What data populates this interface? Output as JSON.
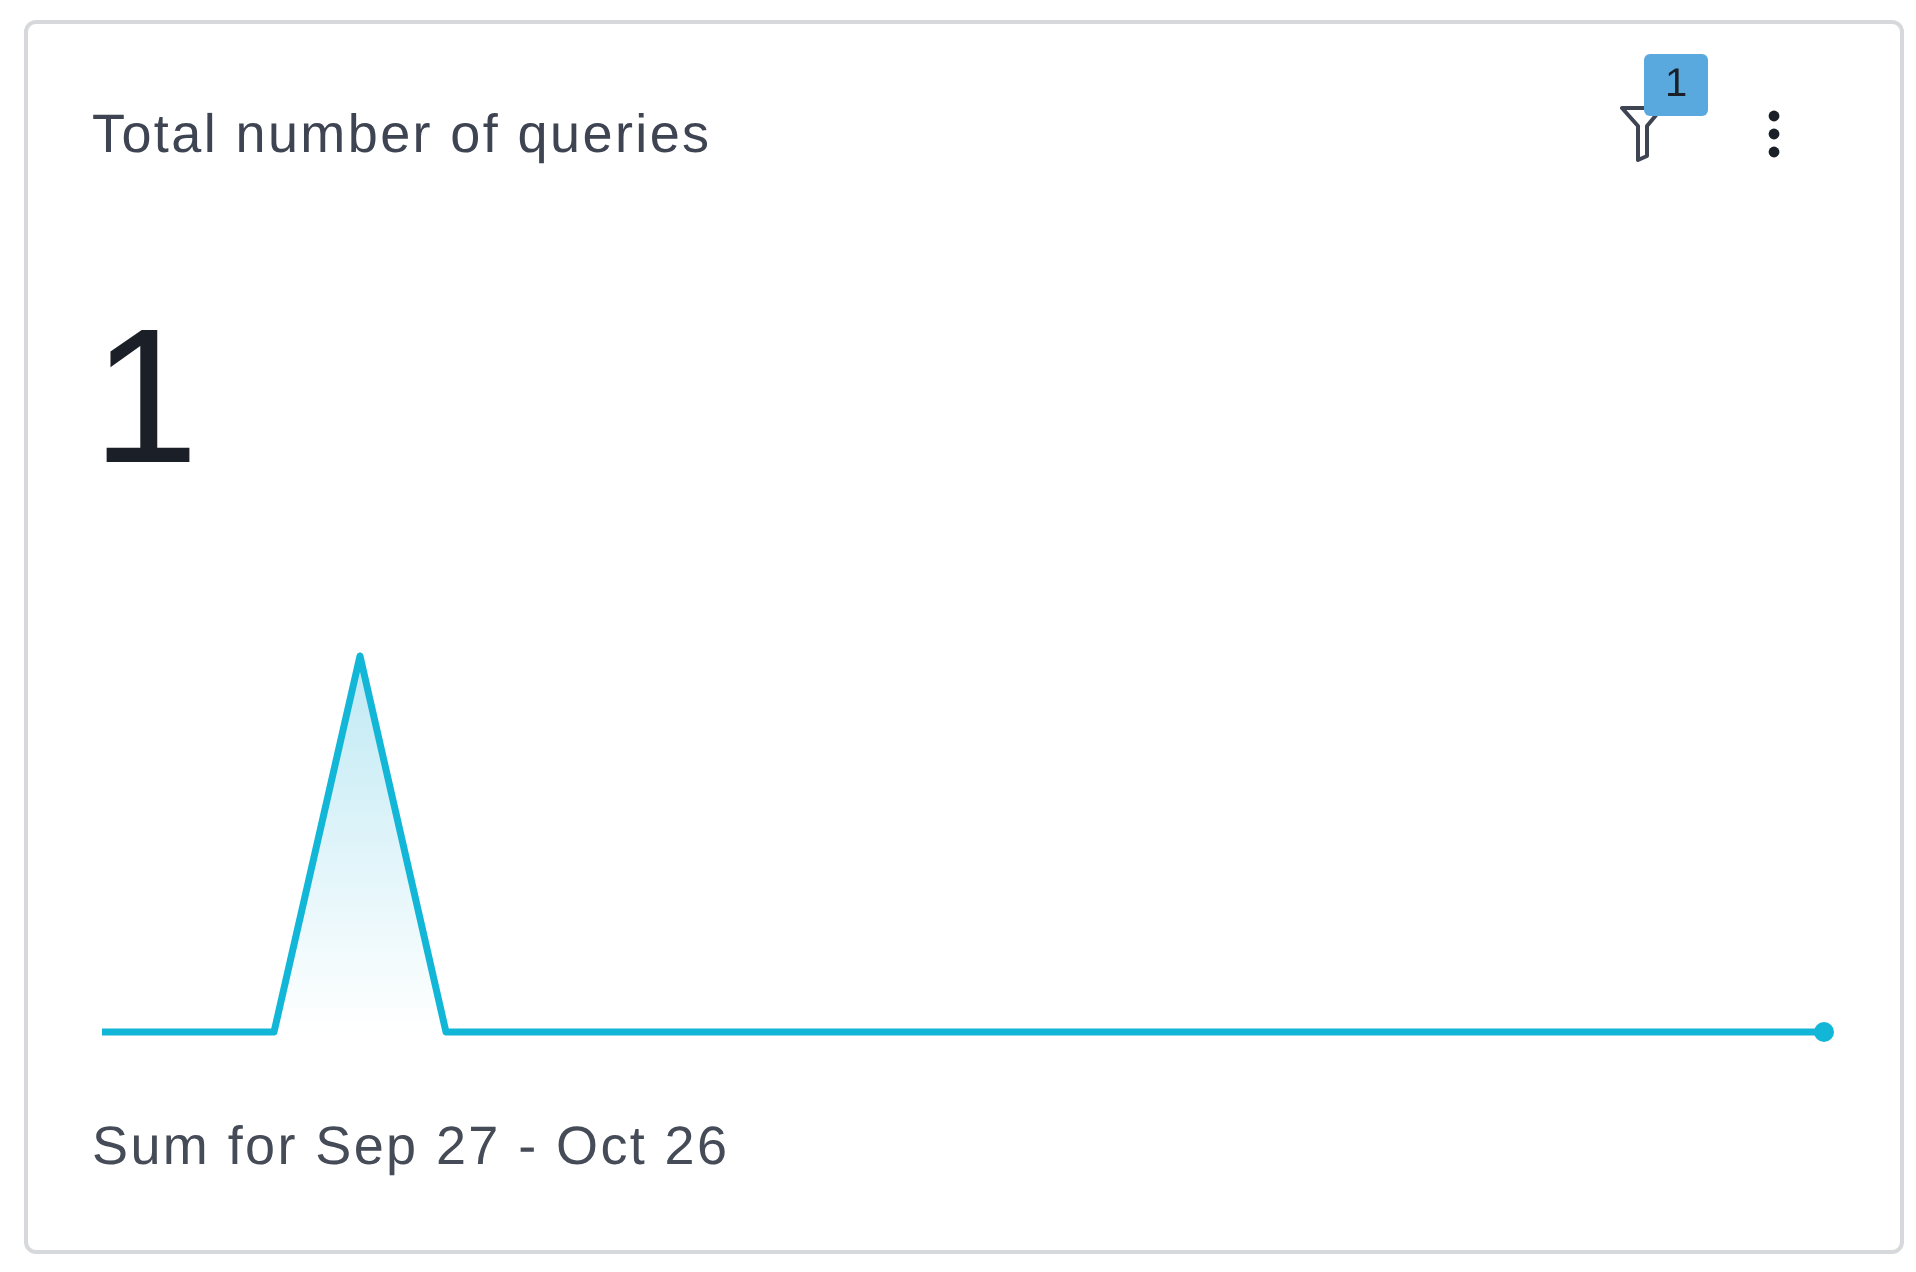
{
  "card": {
    "title": "Total number of queries",
    "filter_badge": "1",
    "value": "1",
    "footer": "Sum for Sep 27 - Oct 26"
  }
}
